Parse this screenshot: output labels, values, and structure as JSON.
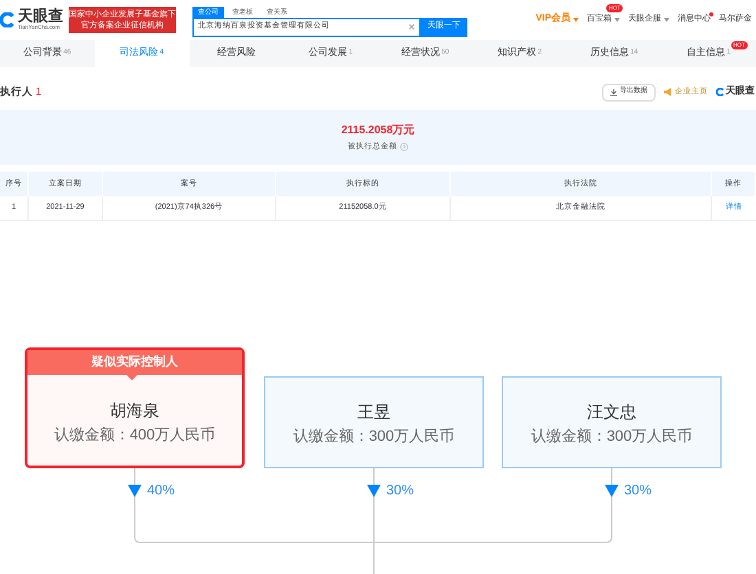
{
  "header": {
    "logo": {
      "name": "天眼查",
      "domain": "TianYanCha.com"
    },
    "badge_lines": [
      "国家中小企业发展子基金旗下",
      "官方备案企业征信机构"
    ],
    "search_tabs": [
      {
        "label": "查公司",
        "selected": true
      },
      {
        "label": "查老板",
        "selected": false
      },
      {
        "label": "查关系",
        "selected": false
      }
    ],
    "search_value": "北京海纳百泉投资基金管理有限公司",
    "search_button": "天眼一下",
    "nav": [
      {
        "label": "VIP会员",
        "kind": "vip",
        "dropdown": true,
        "dot": false
      },
      {
        "label": "百宝箱",
        "kind": "link",
        "dropdown": true,
        "dot": false,
        "badge": "HOT"
      },
      {
        "label": "天眼企服",
        "kind": "link",
        "dropdown": true,
        "dot": false
      },
      {
        "label": "消息中心",
        "kind": "link",
        "dropdown": false,
        "dot": true
      },
      {
        "label": "马尔萨金",
        "kind": "link",
        "dropdown": false,
        "dot": false
      }
    ]
  },
  "tabs": [
    {
      "label": "公司背景",
      "count": "46",
      "selected": false
    },
    {
      "label": "司法风险",
      "count": "4",
      "selected": true
    },
    {
      "label": "经营风险",
      "selected": false
    },
    {
      "label": "公司发展",
      "count": "1",
      "selected": false
    },
    {
      "label": "经营状况",
      "count": "50",
      "selected": false
    },
    {
      "label": "知识产权",
      "count": "2",
      "selected": false
    },
    {
      "label": "历史信息",
      "count": "14",
      "selected": false
    },
    {
      "label": "自主信息",
      "count": "1",
      "selected": false,
      "badge": "HOT"
    }
  ],
  "section": {
    "title": "执行人",
    "count": "1",
    "export_button": "导出数据",
    "promo_link": "企业主页",
    "brand": "天眼查"
  },
  "summary": {
    "amount": "2115.2058万元",
    "label": "被执行总金额"
  },
  "table": {
    "columns": [
      "序号",
      "立案日期",
      "案号",
      "执行标的",
      "执行法院",
      "操作"
    ],
    "rows": [
      {
        "cells": [
          "1",
          "2021-11-29",
          "(2021)京74执326号",
          "21152058.0元",
          "北京金融法院"
        ],
        "action": "详情"
      }
    ]
  },
  "equity": {
    "shareholders": [
      {
        "name": "胡海泉",
        "amount": "认缴金额：400万人民币",
        "highlighted": true,
        "tag": "疑似实际控制人",
        "percent": "40%"
      },
      {
        "name": "王昱",
        "amount": "认缴金额：300万人民币",
        "highlighted": false,
        "percent": "30%"
      },
      {
        "name": "汪文忠",
        "amount": "认缴金额：300万人民币",
        "highlighted": false,
        "percent": "30%"
      }
    ]
  }
}
